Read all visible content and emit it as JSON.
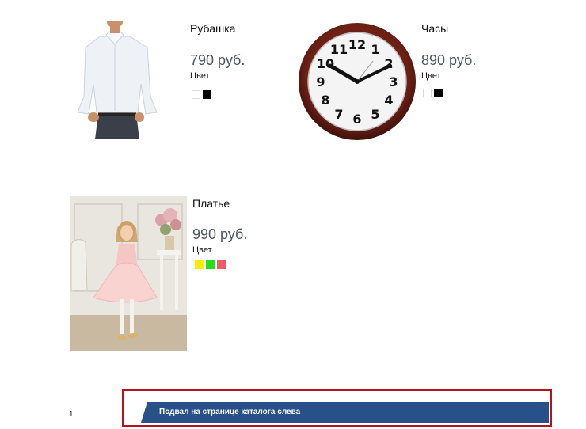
{
  "products": [
    {
      "name": "Рубашка",
      "price": "790 руб.",
      "color_label": "Цвет",
      "image": "shirt",
      "colors": [
        "#ffffff",
        "#000000"
      ]
    },
    {
      "name": "Часы",
      "price": "890 руб.",
      "color_label": "Цвет",
      "image": "clock",
      "colors": [
        "#ffffff",
        "#000000"
      ]
    },
    {
      "name": "Платье",
      "price": "990 руб.",
      "color_label": "Цвет",
      "image": "dress",
      "colors": [
        "#ffea00",
        "#22dd22",
        "#ec5b6b"
      ]
    }
  ],
  "clock_numbers": [
    "12",
    "1",
    "2",
    "3",
    "4",
    "5",
    "6",
    "7",
    "8",
    "9",
    "10",
    "11"
  ],
  "footer": {
    "page_number": "1",
    "text": "Подвал на странице каталога слева",
    "band_color": "#285089",
    "frame_color": "#b3131c"
  }
}
